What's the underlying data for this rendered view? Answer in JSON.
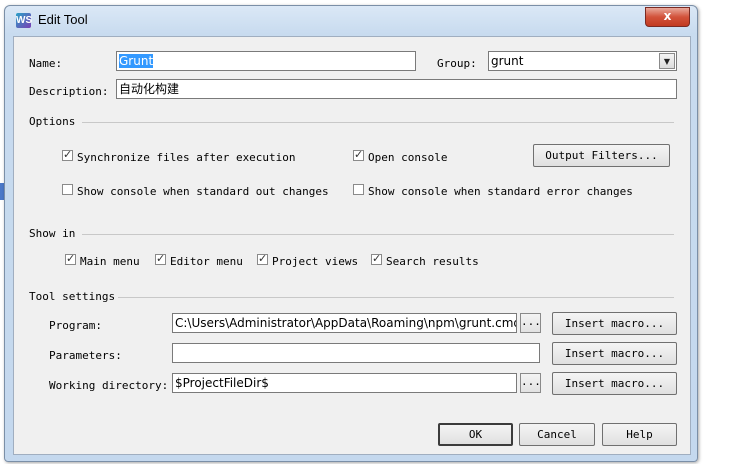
{
  "window": {
    "title": "Edit Tool",
    "app_icon": "WS",
    "close_label": "x"
  },
  "general": {
    "name_label": "Name:",
    "name_value": "Grunt",
    "group_label": "Group:",
    "group_value": "grunt",
    "description_label": "Description:",
    "description_value": "自动化构建"
  },
  "options": {
    "heading": "Options",
    "sync_label": "Synchronize files after execution",
    "sync_checked": true,
    "open_console_label": "Open console",
    "open_console_checked": true,
    "output_filters_label": "Output Filters...",
    "show_console_out_label": "Show console when standard out changes",
    "show_console_out_checked": false,
    "show_console_err_label": "Show console when standard error changes",
    "show_console_err_checked": false
  },
  "show_in": {
    "heading": "Show in",
    "main_menu": "Main menu",
    "editor_menu": "Editor menu",
    "project_views": "Project views",
    "search_results": "Search results"
  },
  "tool_settings": {
    "heading": "Tool settings",
    "program_label": "Program:",
    "program_value": "C:\\Users\\Administrator\\AppData\\Roaming\\npm\\grunt.cmd",
    "parameters_label": "Parameters:",
    "parameters_value": "",
    "workdir_label": "Working directory:",
    "workdir_value": "$ProjectFileDir$",
    "browse_label": "...",
    "insert_macro_label": "Insert macro..."
  },
  "footer": {
    "ok": "OK",
    "cancel": "Cancel",
    "help": "Help"
  },
  "checkmark": "✓"
}
